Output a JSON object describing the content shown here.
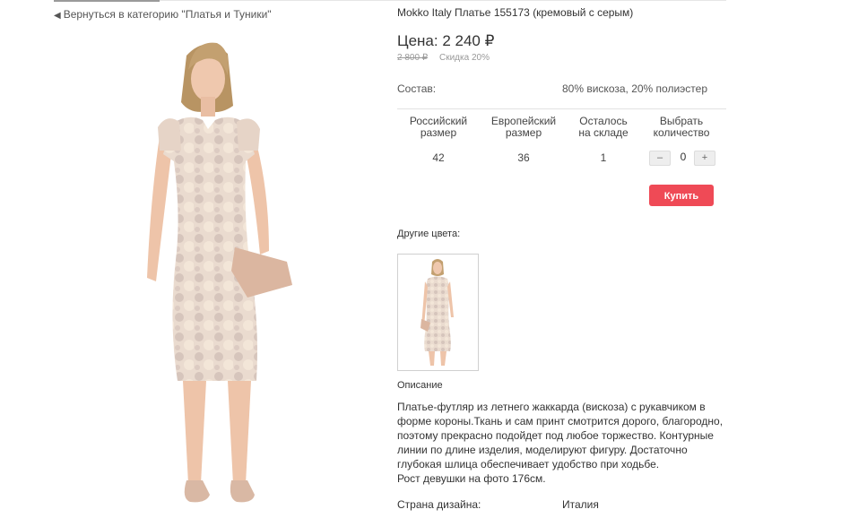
{
  "nav": {
    "back_link": "Вернуться в категорию \"Платья и Туники\""
  },
  "product": {
    "title": "Mokko Italy Платье 155173 (кремовый с серым)",
    "price": "Цена: 2 240 ₽",
    "old_price": "2 800 ₽",
    "discount": "Скидка 20%",
    "composition_label": "Состав:",
    "composition_value": "80% вискоза, 20% полиэстер"
  },
  "size_table": {
    "headers": [
      [
        "Российский",
        "размер"
      ],
      [
        "Европейский",
        "размер"
      ],
      [
        "Осталось",
        "на складе"
      ],
      [
        "Выбрать",
        "количество"
      ]
    ],
    "row": {
      "ru_size": "42",
      "eu_size": "36",
      "stock": "1",
      "quantity": "0"
    },
    "minus": "–",
    "plus": "+"
  },
  "buy_button": "Купить",
  "other_colors": {
    "label": "Другие цвета:"
  },
  "description": {
    "heading": "Описание",
    "lines": [
      "Платье-футляр из летнего жаккарда (вискоза) с рукавчиком в",
      "форме короны.Ткань и сам принт смотрится дорого, благородно,",
      "поэтому прекрасно подойдет под любое торжество. Контурные",
      "линии по длине изделия, моделируют фигуру. Достаточно",
      "глубокая шлица обеспечивает удобство при ходьбе.",
      "Рост девушки на фото 176см."
    ]
  },
  "specs": {
    "country_label": "Страна дизайна:",
    "country_value": "Италия"
  },
  "colors": {
    "buy": "#ef4a56",
    "dress": "#e9d9cc",
    "dress_pattern": "#d4c2b8"
  }
}
